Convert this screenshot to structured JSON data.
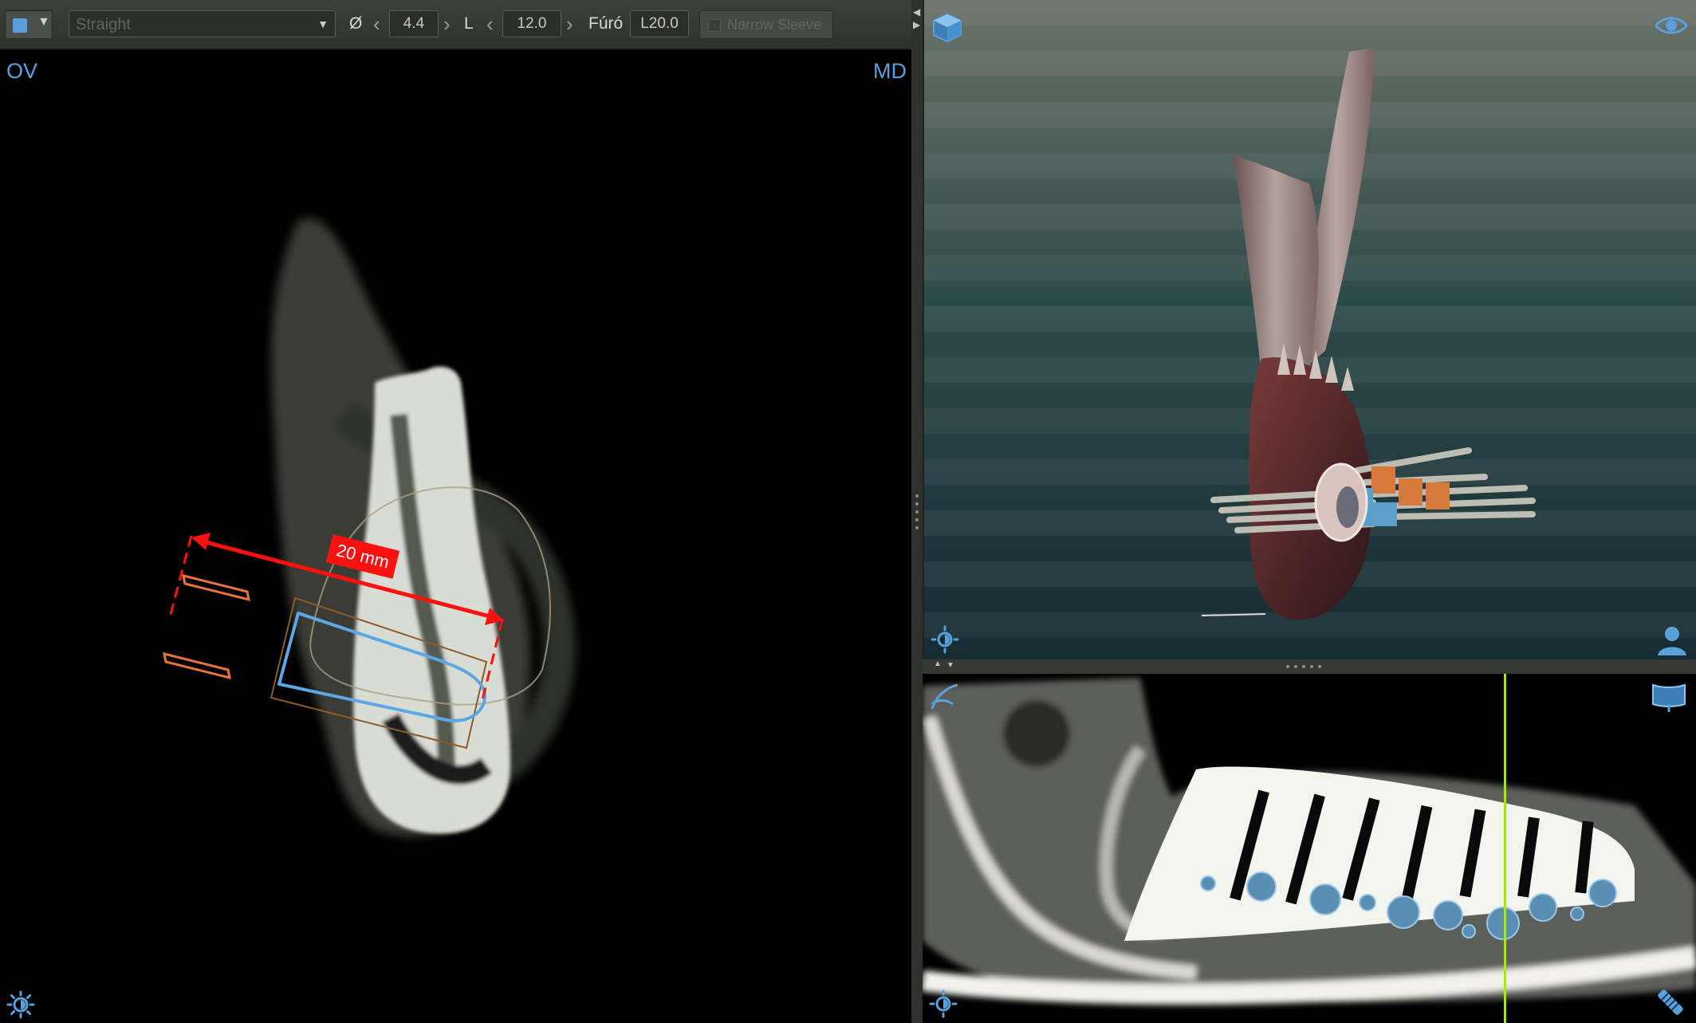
{
  "toolbar": {
    "color_swatch": "#5aa0da",
    "implant_shape": "Straight",
    "diameter_symbol": "Ø",
    "diameter_value": "4.4",
    "length_label": "L",
    "length_value": "12.0",
    "drill_label": "Fúró",
    "drill_value": "L20.0",
    "narrow_sleeve_label": "Narrow Sleeve"
  },
  "cross_section": {
    "left_label": "OV",
    "right_label": "MD",
    "measurement_label": "20 mm"
  },
  "colors": {
    "accent": "#5aa0da",
    "measurement": "#ff1010",
    "guide_sleeve": "#e8743a",
    "panoramic_line": "#a6e22e"
  },
  "icons": {
    "brightness": "brightness-icon",
    "view_3d": "cube-icon",
    "visibility": "eye-icon",
    "patient_orientation": "person-icon",
    "curve_edit": "curve-icon",
    "panoramic_view": "panorama-icon",
    "implant": "implant-icon"
  }
}
